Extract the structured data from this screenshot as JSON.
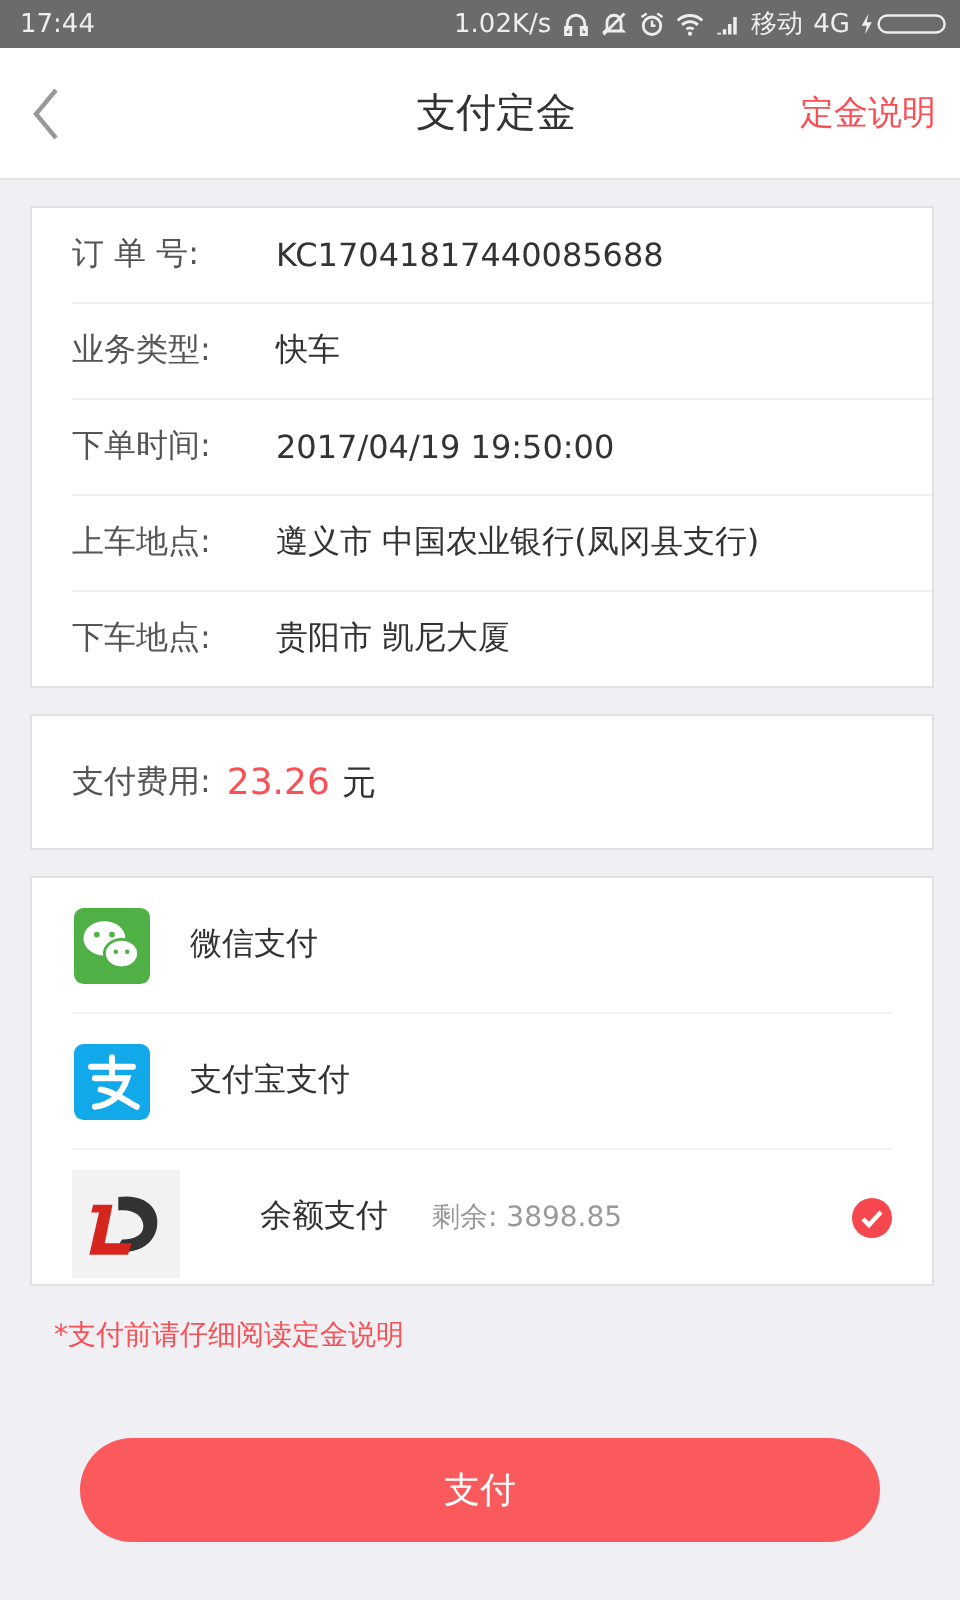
{
  "status_bar": {
    "time": "17:44",
    "speed": "1.02K/s",
    "carrier": "移动",
    "network": "4G"
  },
  "nav": {
    "title": "支付定金",
    "action": "定金说明"
  },
  "order": [
    {
      "label": "订 单 号:",
      "value": "KC17041817440085688"
    },
    {
      "label": "业务类型:",
      "value": "快车"
    },
    {
      "label": "下单时间:",
      "value": "2017/04/19 19:50:00"
    },
    {
      "label": "上车地点:",
      "value": "遵义市 中国农业银行(凤冈县支行)"
    },
    {
      "label": "下车地点:",
      "value": "贵阳市 凯尼大厦"
    }
  ],
  "fee": {
    "label": "支付费用:",
    "amount": "23.26",
    "unit": "元"
  },
  "payment_methods": [
    {
      "kind": "wechat",
      "name": "微信支付",
      "selected": false
    },
    {
      "kind": "alipay",
      "name": "支付宝支付",
      "selected": false
    },
    {
      "kind": "balance",
      "name": "余额支付",
      "balance": "剩余: 3898.85",
      "selected": true
    }
  ],
  "note": "*支付前请仔细阅读定金说明",
  "pay_button": "支付"
}
